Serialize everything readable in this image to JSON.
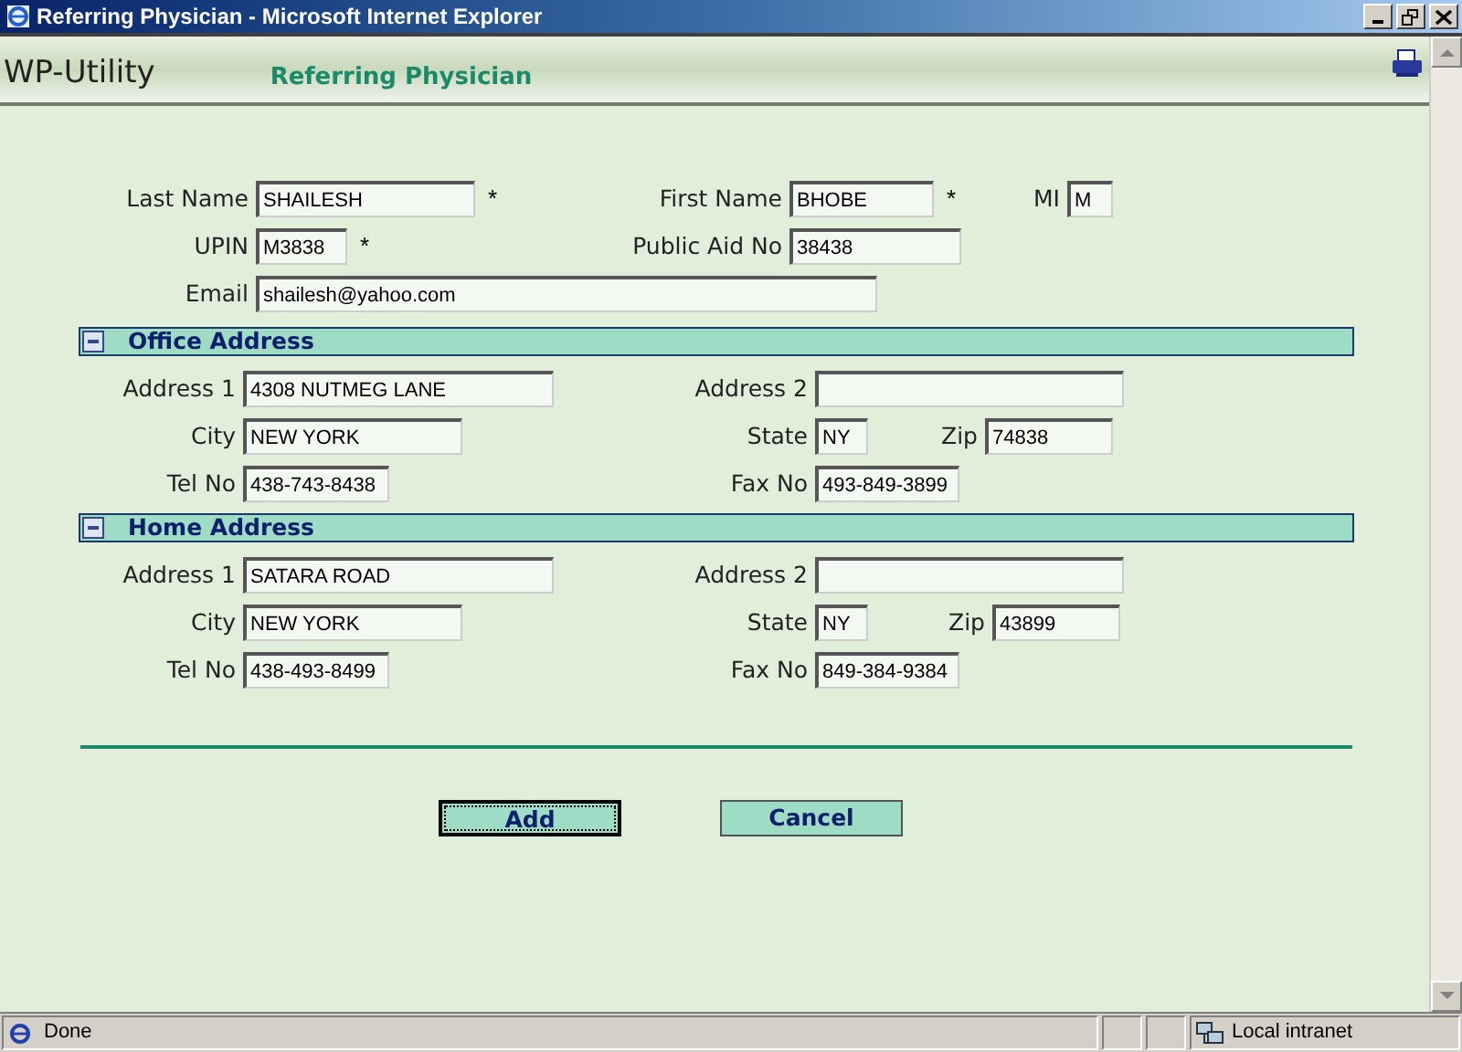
{
  "window": {
    "title": "Referring Physician - Microsoft Internet Explorer"
  },
  "header": {
    "logo": "WP-Utility",
    "page_title": "Referring Physician"
  },
  "personal": [
    [
      {
        "label": "Last Name",
        "value": "SHAILESH",
        "marker": "*"
      },
      {
        "label": "First Name",
        "value": "BHOBE",
        "marker": "*"
      },
      {
        "label": "MI",
        "value": "M"
      }
    ],
    [
      {
        "label": "UPIN",
        "value": "M3838",
        "marker": "*"
      },
      {
        "label": "Public Aid No",
        "value": "38438"
      }
    ],
    [
      {
        "label": "Email",
        "value": "shailesh@yahoo.com"
      }
    ]
  ],
  "sections": [
    {
      "title": "Office Address",
      "expanded": true,
      "rows": [
        [
          {
            "label": "Address 1",
            "value": "4308 NUTMEG LANE"
          },
          {
            "label": "Address 2"
          }
        ],
        [
          {
            "label": "City",
            "value": "NEW YORK"
          },
          {
            "label": "State",
            "value": "NY"
          },
          {
            "label": "Zip",
            "value": "74838"
          }
        ],
        [
          {
            "label": "Tel No",
            "value": "438-743-8438"
          },
          {
            "label": "Fax No",
            "value": "493-849-3899"
          }
        ]
      ]
    },
    {
      "title": "Home Address",
      "expanded": true,
      "rows": [
        [
          {
            "label": "Address 1",
            "value": "SATARA ROAD"
          },
          {
            "label": "Address 2"
          }
        ],
        [
          {
            "label": "City",
            "value": "NEW YORK"
          },
          {
            "label": "State",
            "value": "NY"
          },
          {
            "label": "Zip",
            "value": "43899"
          }
        ],
        [
          {
            "label": "Tel No",
            "value": "438-493-8499"
          },
          {
            "label": "Fax No",
            "value": "849-384-9384"
          }
        ]
      ]
    }
  ],
  "buttons": [
    {
      "label": "Add",
      "focused": true
    },
    {
      "label": "Cancel",
      "focused": false
    }
  ],
  "status_bar": {
    "text": "Done",
    "zone": "Local intranet"
  }
}
